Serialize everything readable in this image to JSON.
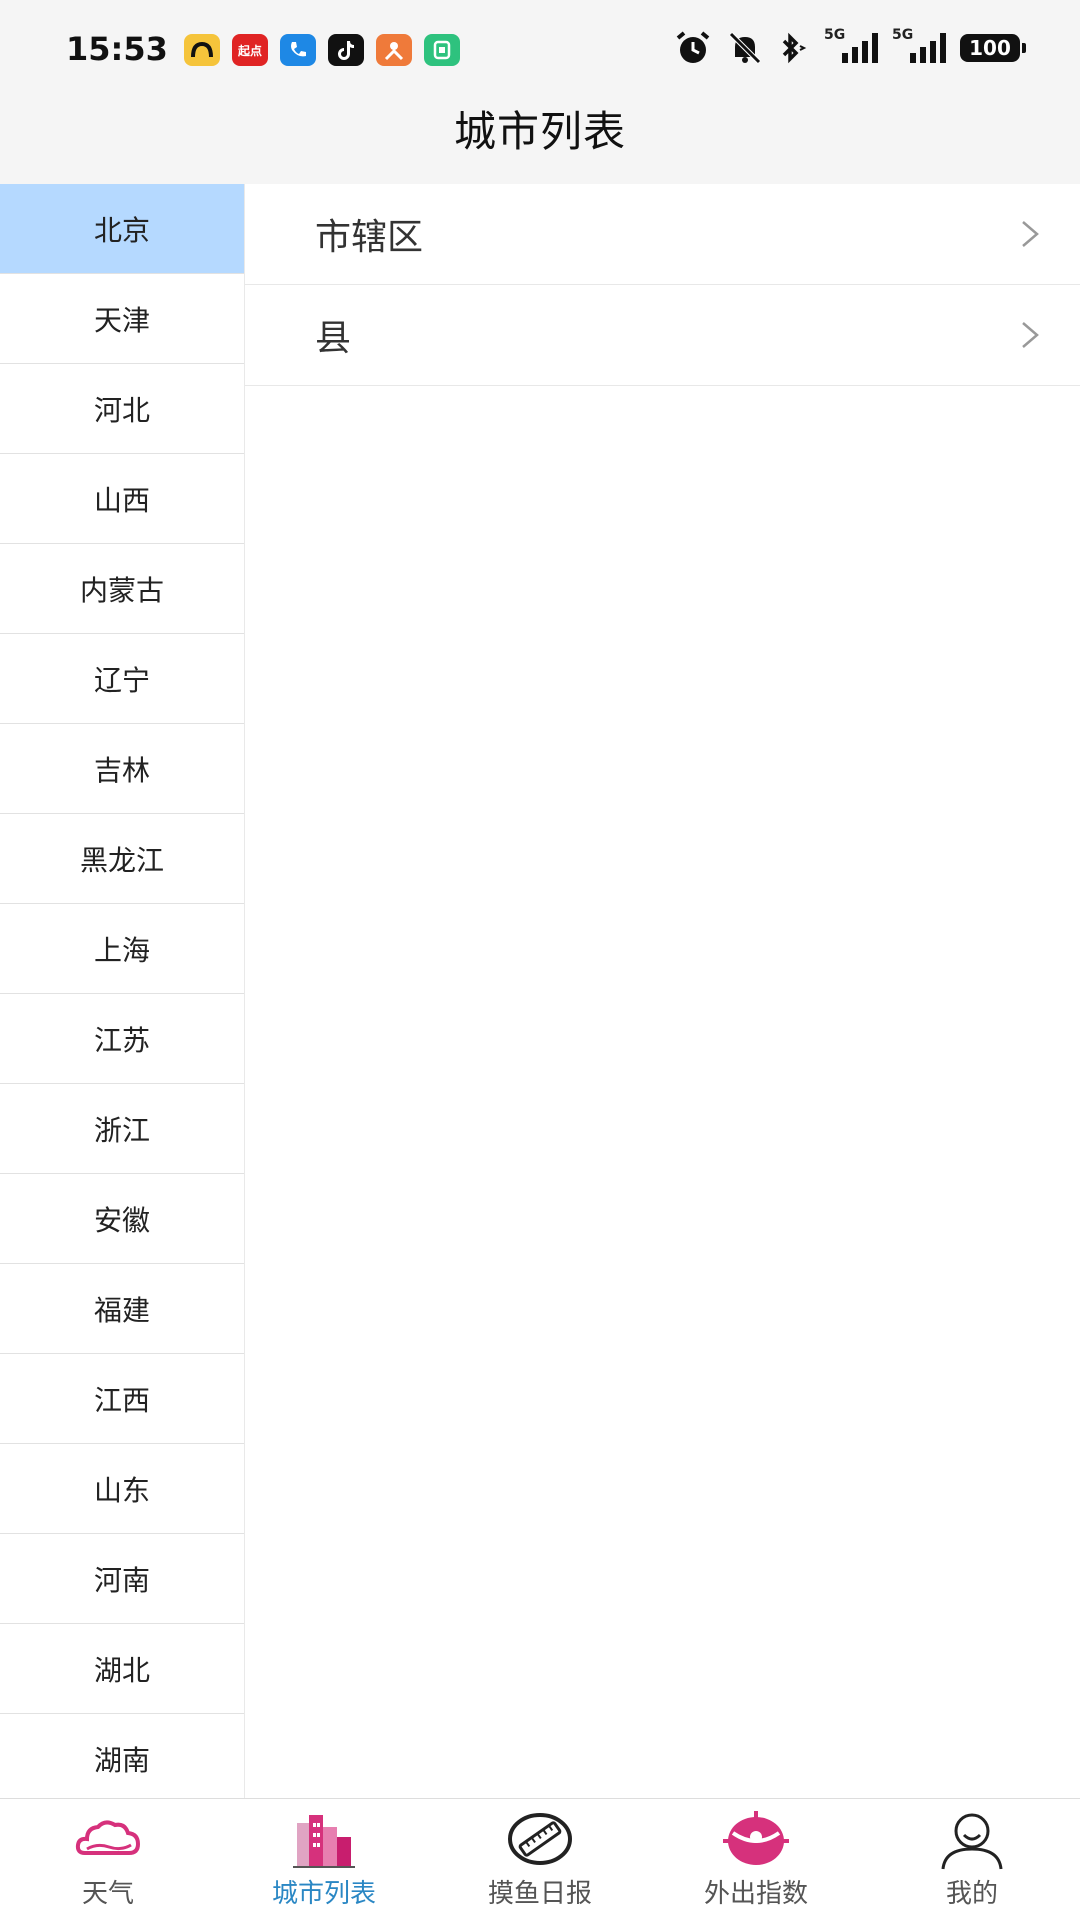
{
  "status_bar": {
    "time": "15:53",
    "app_icons": [
      {
        "name": "amap-icon",
        "color": "#f5c43b"
      },
      {
        "name": "qidian-icon",
        "color": "#e02424",
        "text": "起点"
      },
      {
        "name": "phone-app-icon",
        "color": "#1e88e5"
      },
      {
        "name": "tiktok-icon",
        "color": "#111111"
      },
      {
        "name": "orange-app-icon",
        "color": "#ef7a3a"
      },
      {
        "name": "green-app-icon",
        "color": "#2ec27e"
      }
    ],
    "network_label_1": "5G",
    "network_label_2": "5G",
    "battery": "100"
  },
  "header": {
    "title": "城市列表"
  },
  "provinces": [
    "北京",
    "天津",
    "河北",
    "山西",
    "内蒙古",
    "辽宁",
    "吉林",
    "黑龙江",
    "上海",
    "江苏",
    "浙江",
    "安徽",
    "福建",
    "江西",
    "山东",
    "河南",
    "湖北",
    "湖南"
  ],
  "selected_province": "北京",
  "sub_items": [
    "市辖区",
    "县"
  ],
  "tabs": [
    {
      "label": "天气",
      "icon": "cloud-icon",
      "active": false
    },
    {
      "label": "城市列表",
      "icon": "city-buildings-icon",
      "active": true
    },
    {
      "label": "摸鱼日报",
      "icon": "ruler-icon",
      "active": false
    },
    {
      "label": "外出指数",
      "icon": "target-icon",
      "active": false
    },
    {
      "label": "我的",
      "icon": "person-icon",
      "active": false
    }
  ],
  "colors": {
    "selected_row": "#b5d9ff",
    "active_tab_text": "#2a87c4",
    "icon_pink": "#d6317c"
  }
}
